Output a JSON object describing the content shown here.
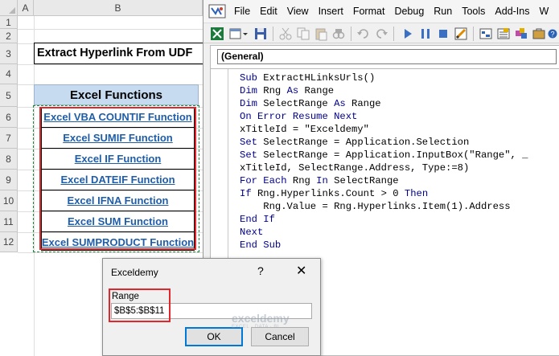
{
  "sheet": {
    "columns": [
      "A",
      "B"
    ],
    "rows": [
      "1",
      "2",
      "3",
      "4",
      "5",
      "6",
      "7",
      "8",
      "9",
      "10",
      "11",
      "12"
    ],
    "title": "Extract Hyperlink From UDF",
    "functions_header": "Excel Functions",
    "functions": [
      "Excel VBA COUNTIF Function",
      "Excel SUMIF Function",
      "Excel IF Function",
      "Excel DATEIF Function",
      "Excel IFNA Function",
      "Excel SUM Function",
      "Excel SUMPRODUCT Function"
    ]
  },
  "vbe": {
    "menu": [
      "File",
      "Edit",
      "View",
      "Insert",
      "Format",
      "Debug",
      "Run",
      "Tools",
      "Add-Ins",
      "W"
    ],
    "object_dropdown": "(General)",
    "code_lines": [
      "Sub ExtractHLinksUrls()",
      "Dim Rng As Range",
      "Dim SelectRange As Range",
      "On Error Resume Next",
      "xTitleId = \"Exceldemy\"",
      "Set SelectRange = Application.Selection",
      "Set SelectRange = Application.InputBox(\"Range\", _",
      "xTitleId, SelectRange.Address, Type:=8)",
      "For Each Rng In SelectRange",
      "If Rng.Hyperlinks.Count > 0 Then",
      "    Rng.Value = Rng.Hyperlinks.Item(1).Address",
      "End If",
      "Next",
      "End Sub"
    ]
  },
  "dialog": {
    "title": "Exceldemy",
    "help": "?",
    "close": "✕",
    "label": "Range",
    "value": "$B$5:$B$11",
    "ok": "OK",
    "cancel": "Cancel"
  },
  "watermark": {
    "name": "exceldemy",
    "tagline": "EXCEL · DATA · BI"
  },
  "colors": {
    "link": "#1f5da8",
    "highlight_red": "#e3262b",
    "header_fill": "#c6dbf0",
    "keyword_blue": "#00008b"
  }
}
